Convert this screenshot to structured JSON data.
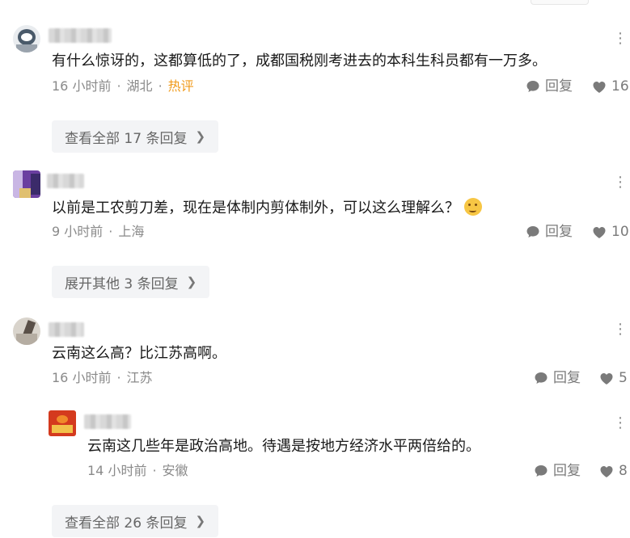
{
  "comments": [
    {
      "text": "有什么惊讶的，这都算低的了，成都国税刚考进去的本科生科员都有一万多。",
      "time": "16 小时前",
      "location": "湖北",
      "badge": "热评",
      "reply_label": "回复",
      "likes": "16(",
      "show_replies": "查看全部 17 条回复"
    },
    {
      "text": "以前是工农剪刀差，现在是体制内剪体制外，可以这么理解么？",
      "emoji": "thinking-face-emoji",
      "time": "9 小时前",
      "location": "上海",
      "reply_label": "回复",
      "likes": "10.",
      "show_replies": "展开其他 3 条回复"
    },
    {
      "text": "云南这么高？比江苏高啊。",
      "time": "16 小时前",
      "location": "江苏",
      "reply_label": "回复",
      "likes": "5",
      "reply": {
        "text": "云南这几些年是政治高地。待遇是按地方经济水平两倍给的。",
        "time": "14 小时前",
        "location": "安徽",
        "reply_label": "回复",
        "likes": "8"
      },
      "show_replies": "查看全部 26 条回复"
    }
  ],
  "icons": {
    "reply": "comment-bubble-icon",
    "like": "heart-icon",
    "more": "more-dots-icon",
    "chevron": "chevron-right-icon"
  },
  "colors": {
    "hot": "#f09a1a",
    "meta": "#8a8a8a",
    "button_bg": "#f3f4f6"
  }
}
